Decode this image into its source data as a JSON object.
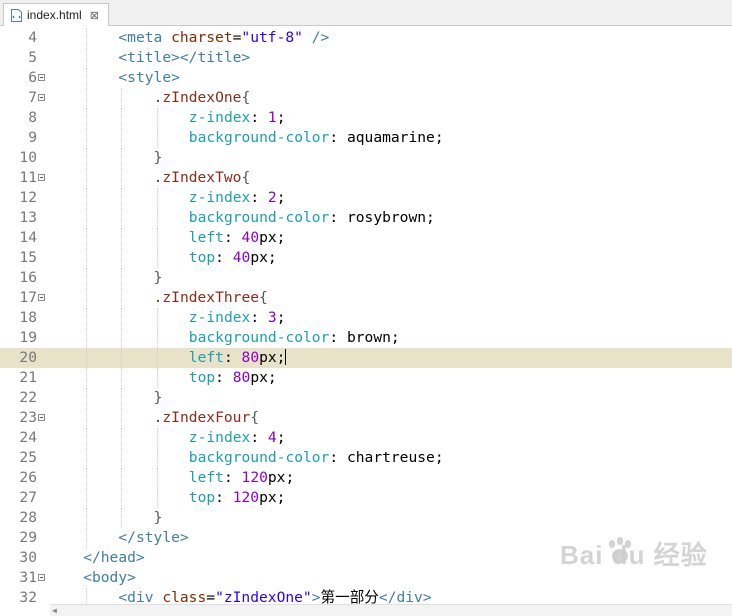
{
  "tab": {
    "filename": "index.html",
    "close_glyph": "⊠"
  },
  "watermark": {
    "text": "Bai du 经验"
  },
  "lines": [
    {
      "n": "4",
      "fold": false,
      "indent": 2,
      "current": false,
      "tokens": [
        {
          "c": "t-tag",
          "t": "<meta "
        },
        {
          "c": "t-attr",
          "t": "charset"
        },
        {
          "c": "t-txt",
          "t": "="
        },
        {
          "c": "t-val",
          "t": "\"utf-8\""
        },
        {
          "c": "t-tag",
          "t": " />"
        }
      ]
    },
    {
      "n": "5",
      "fold": false,
      "indent": 2,
      "current": false,
      "tokens": [
        {
          "c": "t-tag",
          "t": "<title></title>"
        }
      ]
    },
    {
      "n": "6",
      "fold": true,
      "indent": 2,
      "current": false,
      "tokens": [
        {
          "c": "t-tag",
          "t": "<style>"
        }
      ]
    },
    {
      "n": "7",
      "fold": true,
      "indent": 3,
      "current": false,
      "tokens": [
        {
          "c": "t-sel",
          "t": ".zIndexOne"
        },
        {
          "c": "t-brace",
          "t": "{"
        }
      ]
    },
    {
      "n": "8",
      "fold": false,
      "indent": 4,
      "current": false,
      "tokens": [
        {
          "c": "t-prop",
          "t": "z-index"
        },
        {
          "c": "t-txt",
          "t": ": "
        },
        {
          "c": "t-num",
          "t": "1"
        },
        {
          "c": "t-txt",
          "t": ";"
        }
      ]
    },
    {
      "n": "9",
      "fold": false,
      "indent": 4,
      "current": false,
      "tokens": [
        {
          "c": "t-prop",
          "t": "background-color"
        },
        {
          "c": "t-txt",
          "t": ": aquamarine;"
        }
      ]
    },
    {
      "n": "10",
      "fold": false,
      "indent": 3,
      "current": false,
      "tokens": [
        {
          "c": "t-brace",
          "t": "}"
        }
      ]
    },
    {
      "n": "11",
      "fold": true,
      "indent": 3,
      "current": false,
      "tokens": [
        {
          "c": "t-sel",
          "t": ".zIndexTwo"
        },
        {
          "c": "t-brace",
          "t": "{"
        }
      ]
    },
    {
      "n": "12",
      "fold": false,
      "indent": 4,
      "current": false,
      "tokens": [
        {
          "c": "t-prop",
          "t": "z-index"
        },
        {
          "c": "t-txt",
          "t": ": "
        },
        {
          "c": "t-num",
          "t": "2"
        },
        {
          "c": "t-txt",
          "t": ";"
        }
      ]
    },
    {
      "n": "13",
      "fold": false,
      "indent": 4,
      "current": false,
      "tokens": [
        {
          "c": "t-prop",
          "t": "background-color"
        },
        {
          "c": "t-txt",
          "t": ": rosybrown;"
        }
      ]
    },
    {
      "n": "14",
      "fold": false,
      "indent": 4,
      "current": false,
      "tokens": [
        {
          "c": "t-prop",
          "t": "left"
        },
        {
          "c": "t-txt",
          "t": ": "
        },
        {
          "c": "t-num",
          "t": "40"
        },
        {
          "c": "t-txt",
          "t": "px;"
        }
      ]
    },
    {
      "n": "15",
      "fold": false,
      "indent": 4,
      "current": false,
      "tokens": [
        {
          "c": "t-prop",
          "t": "top"
        },
        {
          "c": "t-txt",
          "t": ": "
        },
        {
          "c": "t-num",
          "t": "40"
        },
        {
          "c": "t-txt",
          "t": "px;"
        }
      ]
    },
    {
      "n": "16",
      "fold": false,
      "indent": 3,
      "current": false,
      "tokens": [
        {
          "c": "t-brace",
          "t": "}"
        }
      ]
    },
    {
      "n": "17",
      "fold": true,
      "indent": 3,
      "current": false,
      "tokens": [
        {
          "c": "t-sel",
          "t": ".zIndexThree"
        },
        {
          "c": "t-brace",
          "t": "{"
        }
      ]
    },
    {
      "n": "18",
      "fold": false,
      "indent": 4,
      "current": false,
      "tokens": [
        {
          "c": "t-prop",
          "t": "z-index"
        },
        {
          "c": "t-txt",
          "t": ": "
        },
        {
          "c": "t-num",
          "t": "3"
        },
        {
          "c": "t-txt",
          "t": ";"
        }
      ]
    },
    {
      "n": "19",
      "fold": false,
      "indent": 4,
      "current": false,
      "tokens": [
        {
          "c": "t-prop",
          "t": "background-color"
        },
        {
          "c": "t-txt",
          "t": ": brown;"
        }
      ]
    },
    {
      "n": "20",
      "fold": false,
      "indent": 4,
      "current": true,
      "tokens": [
        {
          "c": "t-prop",
          "t": "left"
        },
        {
          "c": "t-txt",
          "t": ": "
        },
        {
          "c": "t-num",
          "t": "80"
        },
        {
          "c": "t-txt",
          "t": "px;"
        }
      ]
    },
    {
      "n": "21",
      "fold": false,
      "indent": 4,
      "current": false,
      "tokens": [
        {
          "c": "t-prop",
          "t": "top"
        },
        {
          "c": "t-txt",
          "t": ": "
        },
        {
          "c": "t-num",
          "t": "80"
        },
        {
          "c": "t-txt",
          "t": "px;"
        }
      ]
    },
    {
      "n": "22",
      "fold": false,
      "indent": 3,
      "current": false,
      "tokens": [
        {
          "c": "t-brace",
          "t": "}"
        }
      ]
    },
    {
      "n": "23",
      "fold": true,
      "indent": 3,
      "current": false,
      "tokens": [
        {
          "c": "t-sel",
          "t": ".zIndexFour"
        },
        {
          "c": "t-brace",
          "t": "{"
        }
      ]
    },
    {
      "n": "24",
      "fold": false,
      "indent": 4,
      "current": false,
      "tokens": [
        {
          "c": "t-prop",
          "t": "z-index"
        },
        {
          "c": "t-txt",
          "t": ": "
        },
        {
          "c": "t-num",
          "t": "4"
        },
        {
          "c": "t-txt",
          "t": ";"
        }
      ]
    },
    {
      "n": "25",
      "fold": false,
      "indent": 4,
      "current": false,
      "tokens": [
        {
          "c": "t-prop",
          "t": "background-color"
        },
        {
          "c": "t-txt",
          "t": ": chartreuse;"
        }
      ]
    },
    {
      "n": "26",
      "fold": false,
      "indent": 4,
      "current": false,
      "tokens": [
        {
          "c": "t-prop",
          "t": "left"
        },
        {
          "c": "t-txt",
          "t": ": "
        },
        {
          "c": "t-num",
          "t": "120"
        },
        {
          "c": "t-txt",
          "t": "px;"
        }
      ]
    },
    {
      "n": "27",
      "fold": false,
      "indent": 4,
      "current": false,
      "tokens": [
        {
          "c": "t-prop",
          "t": "top"
        },
        {
          "c": "t-txt",
          "t": ": "
        },
        {
          "c": "t-num",
          "t": "120"
        },
        {
          "c": "t-txt",
          "t": "px;"
        }
      ]
    },
    {
      "n": "28",
      "fold": false,
      "indent": 3,
      "current": false,
      "tokens": [
        {
          "c": "t-brace",
          "t": "}"
        }
      ]
    },
    {
      "n": "29",
      "fold": false,
      "indent": 2,
      "current": false,
      "tokens": [
        {
          "c": "t-tag",
          "t": "</style>"
        }
      ]
    },
    {
      "n": "30",
      "fold": false,
      "indent": 1,
      "current": false,
      "tokens": [
        {
          "c": "t-tag",
          "t": "</head>"
        }
      ]
    },
    {
      "n": "31",
      "fold": true,
      "indent": 1,
      "current": false,
      "tokens": [
        {
          "c": "t-tag",
          "t": "<body>"
        }
      ]
    },
    {
      "n": "32",
      "fold": false,
      "indent": 2,
      "current": false,
      "tokens": [
        {
          "c": "t-tag",
          "t": "<div "
        },
        {
          "c": "t-attr",
          "t": "class"
        },
        {
          "c": "t-txt",
          "t": "="
        },
        {
          "c": "t-val",
          "t": "\"zIndexOne\""
        },
        {
          "c": "t-tag",
          "t": ">"
        },
        {
          "c": "t-txt",
          "t": "第一部分"
        },
        {
          "c": "t-tag",
          "t": "</div>"
        }
      ]
    }
  ]
}
